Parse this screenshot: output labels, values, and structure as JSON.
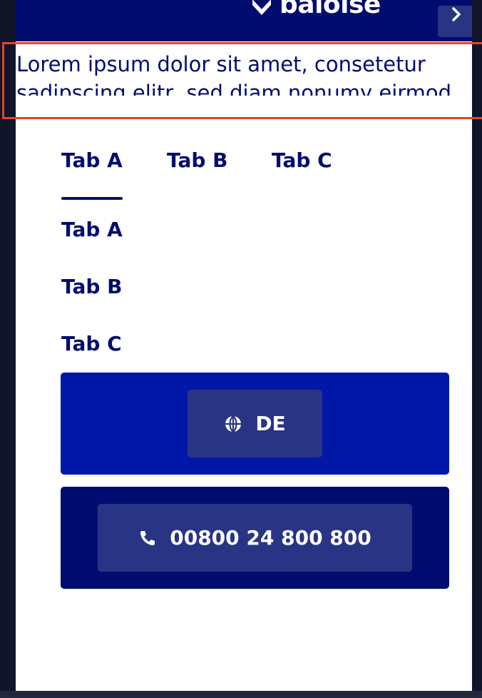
{
  "header": {
    "brand": "baloise",
    "brand_icon": "baloise-logo-icon",
    "menu_icon": "chevron-right-icon",
    "colors": {
      "primary": "#000d6e",
      "accent": "#0018a8",
      "button": "#293485",
      "highlight": "#e2452b"
    }
  },
  "notice": {
    "text": "Lorem ipsum dolor sit amet, consetetur sadipscing elitr, sed diam nonumy eirmod"
  },
  "tabs": [
    {
      "label": "Tab A",
      "active": true
    },
    {
      "label": "Tab B",
      "active": false
    },
    {
      "label": "Tab C",
      "active": false
    }
  ],
  "list": [
    {
      "label": "Tab A"
    },
    {
      "label": "Tab B"
    },
    {
      "label": "Tab C"
    }
  ],
  "language": {
    "label": "DE",
    "icon": "globe-icon"
  },
  "phone": {
    "label": "00800 24 800 800",
    "icon": "phone-icon"
  }
}
